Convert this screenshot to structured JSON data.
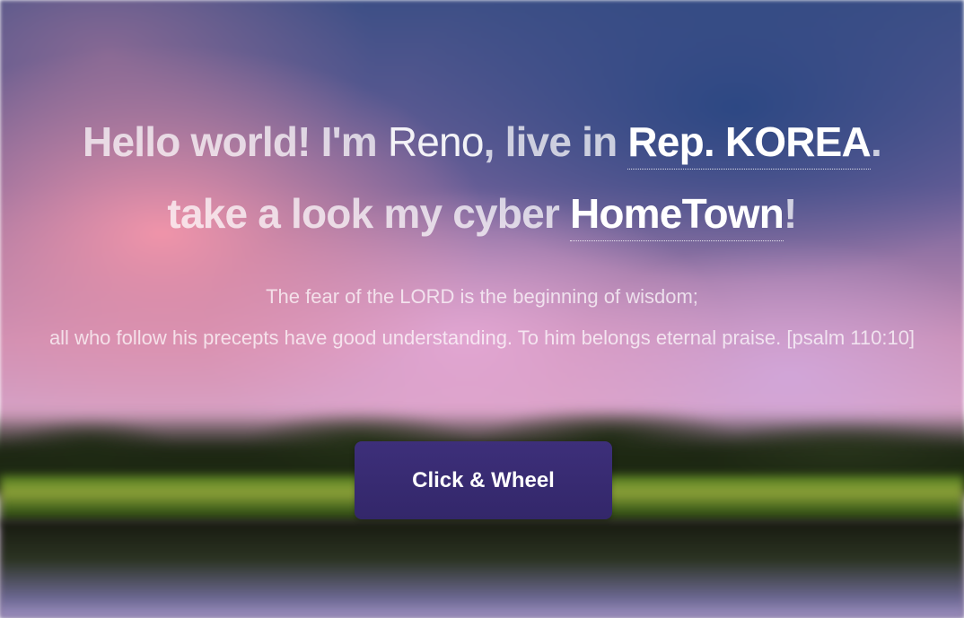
{
  "hero": {
    "headline": {
      "line1_a": "Hello world! I'm ",
      "name": "Reno",
      "line1_b": ", live in ",
      "country": "Rep. KOREA",
      "line1_end": ".",
      "line2_a": "take a look my cyber ",
      "hometown": "HomeTown",
      "line2_end": "!"
    },
    "verse": {
      "line1": "The fear of the LORD is the beginning of wisdom;",
      "line2": "all who follow his precepts have good understanding. To him belongs eternal praise. [psalm 110:10]"
    },
    "button_label": "Click & Wheel"
  },
  "colors": {
    "button_bg": "#3d2f7a",
    "text": "#ffffff"
  }
}
